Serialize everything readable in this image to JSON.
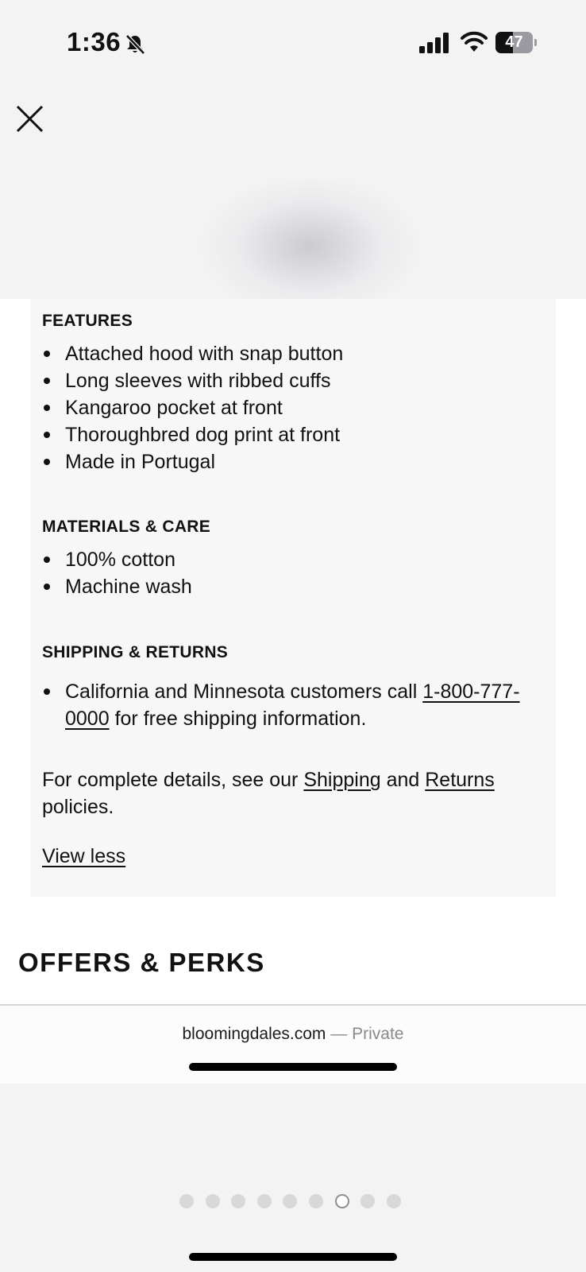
{
  "status_bar": {
    "time": "1:36",
    "battery": "47",
    "battery_level": 0.47
  },
  "details": {
    "features_heading": "FEATURES",
    "features": [
      "Attached hood with snap button",
      "Long sleeves with ribbed cuffs",
      "Kangaroo pocket at front",
      "Thoroughbred dog print at front",
      "Made in Portugal"
    ],
    "materials_heading": "MATERIALS & CARE",
    "materials": [
      "100% cotton",
      "Machine wash"
    ],
    "shipping_heading": "SHIPPING & RETURNS",
    "shipping_text_before": "California and Minnesota customers call ",
    "shipping_phone": "1-800-777-0000",
    "shipping_text_after": " for free shipping information.",
    "policy_text_before": "For complete details, see our ",
    "policy_link_shipping": "Shipping",
    "policy_and": " and ",
    "policy_link_returns": "Returns",
    "policy_text_after": " policies.",
    "view_less": "View less"
  },
  "offers_heading": "OFFERS & PERKS",
  "browser": {
    "domain": "bloomingdales.com",
    "private_label": "— Private"
  },
  "pager": {
    "count": 9,
    "active_index": 6
  }
}
